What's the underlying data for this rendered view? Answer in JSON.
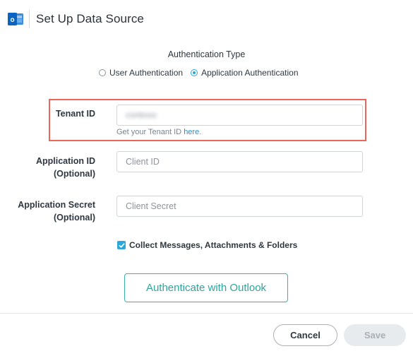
{
  "header": {
    "title": "Set Up Data Source",
    "logo_icon": "outlook-logo-icon",
    "logo_letter": "o"
  },
  "auth_type": {
    "heading": "Authentication Type",
    "options": [
      {
        "label": "User Authentication",
        "selected": false
      },
      {
        "label": "Application Authentication",
        "selected": true
      }
    ]
  },
  "fields": {
    "tenant_id": {
      "label": "Tenant ID",
      "value": "contoso",
      "help_prefix": "Get your Tenant ID ",
      "help_link": "here",
      "help_suffix": "."
    },
    "application_id": {
      "label_line1": "Application ID",
      "label_line2": "(Optional)",
      "placeholder": "Client ID"
    },
    "application_secret": {
      "label_line1": "Application Secret",
      "label_line2": "(Optional)",
      "placeholder": "Client Secret"
    }
  },
  "collect": {
    "label": "Collect Messages, Attachments & Folders",
    "checked": true
  },
  "buttons": {
    "authenticate": "Authenticate with Outlook",
    "cancel": "Cancel",
    "save": "Save"
  },
  "colors": {
    "accent": "#2ca7d8",
    "highlight": "#e8665a",
    "authenticate_border": "#3ab0a6",
    "outlook_blue": "#0a64c1"
  }
}
